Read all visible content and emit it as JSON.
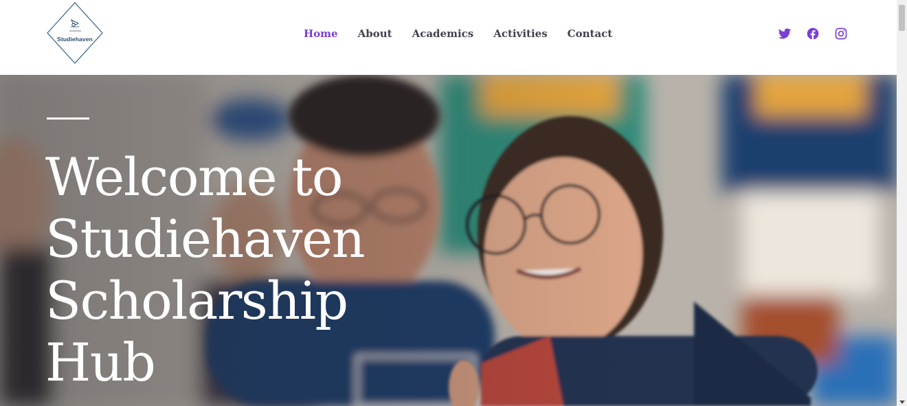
{
  "brand": {
    "name": "Studiehaven",
    "color": "#2e4a70"
  },
  "nav": {
    "items": [
      {
        "label": "Home",
        "active": true
      },
      {
        "label": "About",
        "active": false
      },
      {
        "label": "Academics",
        "active": false
      },
      {
        "label": "Activities",
        "active": false
      },
      {
        "label": "Contact",
        "active": false
      }
    ],
    "active_color": "#7b3fd6",
    "text_color": "#44414f"
  },
  "social": [
    {
      "icon": "twitter-icon"
    },
    {
      "icon": "facebook-icon"
    },
    {
      "icon": "instagram-icon"
    }
  ],
  "social_color": "#7b3fd6",
  "hero": {
    "title": "Welcome to Studiehaven Scholarship Hub",
    "image": "students smiling in a classroom"
  }
}
